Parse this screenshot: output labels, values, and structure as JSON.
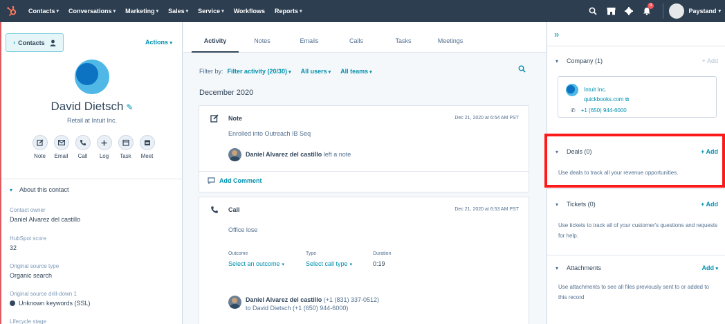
{
  "topnav": {
    "items": [
      "Contacts",
      "Conversations",
      "Marketing",
      "Sales",
      "Service",
      "Workflows",
      "Reports"
    ],
    "has_caret": [
      true,
      true,
      true,
      true,
      true,
      false,
      true
    ],
    "notification_count": "9",
    "account_name": "Paystand"
  },
  "left": {
    "contacts_button": "Contacts",
    "actions_label": "Actions",
    "contact_name": "David Dietsch",
    "contact_subtitle": "Retail at Intuit Inc.",
    "quick_actions": [
      "Note",
      "Email",
      "Call",
      "Log",
      "Task",
      "Meet"
    ],
    "about_title": "About this contact",
    "properties": [
      {
        "label": "Contact owner",
        "value": "Daniel Alvarez del castillo"
      },
      {
        "label": "HubSpot score",
        "value": "32"
      },
      {
        "label": "Original source type",
        "value": "Organic search"
      },
      {
        "label": "Original source drill-down 1",
        "value": "Unknown keywords (SSL)"
      },
      {
        "label": "Lifecycle stage",
        "value": ""
      }
    ]
  },
  "middle": {
    "tabs": [
      "Activity",
      "Notes",
      "Emails",
      "Calls",
      "Tasks",
      "Meetings"
    ],
    "active_tab": "Activity",
    "filter_by_label": "Filter by:",
    "filter_activity": "Filter activity (20/30)",
    "filter_users": "All users",
    "filter_teams": "All teams",
    "month": "December 2020",
    "note_card": {
      "title": "Note",
      "timestamp": "Dec 21, 2020 at 6:54 AM PST",
      "body": "Enrolled into Outreach IB Seq",
      "author": "Daniel Alvarez del castillo",
      "author_action": "left a note",
      "footer": "Add Comment"
    },
    "call_card": {
      "title": "Call",
      "timestamp": "Dec 21, 2020 at 6:53 AM PST",
      "body": "Office lose",
      "outcome_label": "Outcome",
      "outcome_value": "Select an outcome",
      "type_label": "Type",
      "type_value": "Select call type",
      "duration_label": "Duration",
      "duration_value": "0:19",
      "author": "Daniel Alvarez del castillo",
      "author_phone": "(+1 (831) 337-0512)",
      "recipient_line": "to David Dietsch (+1 (650) 944-6000)"
    }
  },
  "right": {
    "company": {
      "header": "Company (1)",
      "add": "+ Add",
      "name": "Intuit Inc.",
      "domain": "quickbooks.com",
      "phone": "+1 (650) 944-6000"
    },
    "deals": {
      "header": "Deals (0)",
      "add": "+ Add",
      "body": "Use deals to track all your revenue opportunities."
    },
    "tickets": {
      "header": "Tickets (0)",
      "add": "+ Add",
      "body": "Use tickets to track all of your customer's questions and requests for help."
    },
    "attachments": {
      "header": "Attachments",
      "add": "Add",
      "body": "Use attachments to see all files previously sent to or added to this record"
    }
  },
  "colors": {
    "nav_bg": "#2d3e50",
    "link": "#0091ae",
    "highlight": "#ff1a1a",
    "brand_orange": "#ff7a59"
  }
}
